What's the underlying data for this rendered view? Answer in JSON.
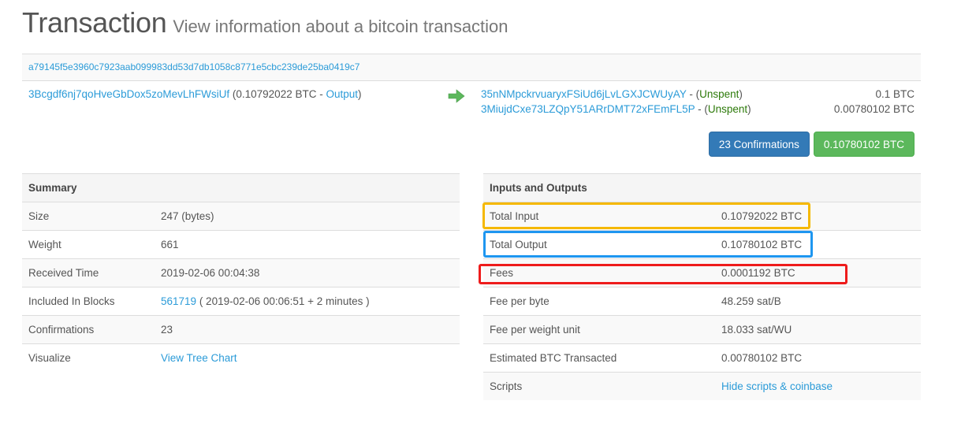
{
  "header": {
    "title": "Transaction",
    "subtitle": "View information about a bitcoin transaction"
  },
  "transaction": {
    "hash": "a79145f5e3960c7923aab099983dd53d7db1058c8771e5cbc239de25ba0419c7",
    "input": {
      "address": "3Bcgdf6nj7qoHveGbDox5zoMevLhFWsiUf",
      "amount_prefix": "(0.10792022 BTC - ",
      "type_link": "Output",
      "suffix": ")"
    },
    "arrow_icon": "arrow-right-icon",
    "outputs": [
      {
        "address": "35nNMpckrvuaryxFSiUd6jLvLGXJCWUyAY",
        "sep": " - (",
        "status": "Unspent",
        "close": ")",
        "amount": "0.1 BTC"
      },
      {
        "address": "3MiujdCxe73LZQpY51ARrDMT72xFEmFL5P",
        "sep": " - (",
        "status": "Unspent",
        "close": ")",
        "amount": "0.00780102 BTC"
      }
    ],
    "confirmations_badge": "23 Confirmations",
    "total_badge": "0.10780102 BTC"
  },
  "summary": {
    "heading": "Summary",
    "rows": [
      {
        "label": "Size",
        "value": "247 (bytes)"
      },
      {
        "label": "Weight",
        "value": "661"
      },
      {
        "label": "Received Time",
        "value": "2019-02-06 00:04:38"
      },
      {
        "label": "Included In Blocks",
        "block_link": "561719",
        "value": " ( 2019-02-06 00:06:51 + 2 minutes )"
      },
      {
        "label": "Confirmations",
        "value": "23"
      },
      {
        "label": "Visualize",
        "link": "View Tree Chart"
      }
    ]
  },
  "inputs_outputs": {
    "heading": "Inputs and Outputs",
    "rows": [
      {
        "label": "Total Input",
        "value": "0.10792022 BTC"
      },
      {
        "label": "Total Output",
        "value": "0.10780102 BTC"
      },
      {
        "label": "Fees",
        "value": "0.0001192 BTC"
      },
      {
        "label": "Fee per byte",
        "value": "48.259 sat/B"
      },
      {
        "label": "Fee per weight unit",
        "value": "18.033 sat/WU"
      },
      {
        "label": "Estimated BTC Transacted",
        "value": "0.00780102 BTC"
      },
      {
        "label": "Scripts",
        "link": "Hide scripts & coinbase"
      }
    ]
  },
  "annotations": {
    "total_input_box_color": "#f5b800",
    "total_output_box_color": "#1e96f0",
    "fees_box_color": "#ee1c1c"
  }
}
